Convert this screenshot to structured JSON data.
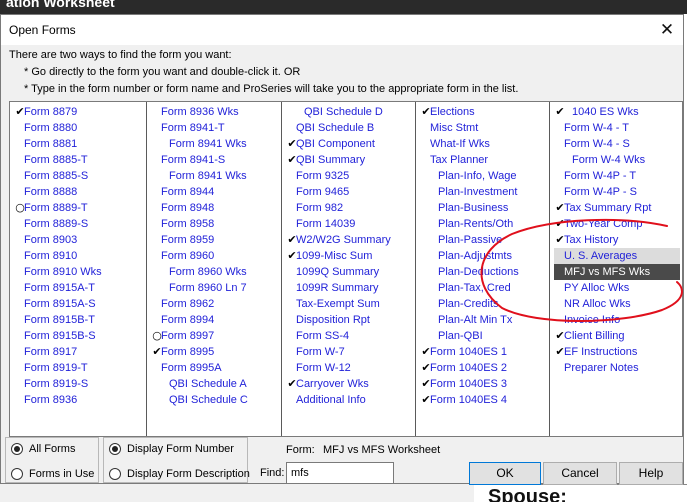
{
  "background": {
    "top_text": "ation Worksheet",
    "spouse_text": "Spouse:"
  },
  "dialog": {
    "title": "Open Forms",
    "close_glyph": "✕",
    "instructions": [
      "There are two ways to find the form you want:",
      "* Go directly to the form you want and double-click it. OR",
      "* Type in the form number or form name and ProSeries will take you to the appropriate form in the list."
    ]
  },
  "columns": [
    [
      {
        "mark": "check",
        "text": "Form 8879"
      },
      {
        "mark": "",
        "text": "Form 8880"
      },
      {
        "mark": "",
        "text": "Form 8881"
      },
      {
        "mark": "",
        "text": "Form 8885-T"
      },
      {
        "mark": "",
        "text": "Form 8885-S"
      },
      {
        "mark": "",
        "text": "Form 8888"
      },
      {
        "mark": "circle",
        "text": "Form 8889-T"
      },
      {
        "mark": "",
        "text": "Form 8889-S"
      },
      {
        "mark": "",
        "text": "Form 8903"
      },
      {
        "mark": "",
        "text": "Form 8910"
      },
      {
        "mark": "",
        "text": "Form 8910 Wks"
      },
      {
        "mark": "",
        "text": "Form 8915A-T"
      },
      {
        "mark": "",
        "text": "Form 8915A-S"
      },
      {
        "mark": "",
        "text": "Form 8915B-T"
      },
      {
        "mark": "",
        "text": "Form 8915B-S"
      },
      {
        "mark": "",
        "text": "Form 8917"
      },
      {
        "mark": "",
        "text": "Form 8919-T"
      },
      {
        "mark": "",
        "text": "Form 8919-S"
      },
      {
        "mark": "",
        "text": "Form 8936"
      }
    ],
    [
      {
        "mark": "",
        "text": "Form 8936 Wks"
      },
      {
        "mark": "",
        "text": "Form 8941-T"
      },
      {
        "mark": "",
        "text": "Form 8941 Wks",
        "indent": 1
      },
      {
        "mark": "",
        "text": "Form 8941-S"
      },
      {
        "mark": "",
        "text": "Form 8941 Wks",
        "indent": 1
      },
      {
        "mark": "",
        "text": "Form 8944"
      },
      {
        "mark": "",
        "text": "Form 8948"
      },
      {
        "mark": "",
        "text": "Form 8958"
      },
      {
        "mark": "",
        "text": "Form 8959"
      },
      {
        "mark": "",
        "text": "Form 8960"
      },
      {
        "mark": "",
        "text": "Form 8960 Wks",
        "indent": 1
      },
      {
        "mark": "",
        "text": "Form 8960 Ln 7",
        "indent": 1
      },
      {
        "mark": "",
        "text": "Form 8962"
      },
      {
        "mark": "",
        "text": "Form 8994"
      },
      {
        "mark": "circle",
        "text": "Form 8997"
      },
      {
        "mark": "check",
        "text": "Form 8995"
      },
      {
        "mark": "",
        "text": "Form 8995A"
      },
      {
        "mark": "",
        "text": "QBI Schedule A",
        "indent": 1
      },
      {
        "mark": "",
        "text": "QBI Schedule C",
        "indent": 1
      }
    ],
    [
      {
        "mark": "",
        "text": "QBI Schedule D",
        "indent": 1
      },
      {
        "mark": "",
        "text": "QBI Schedule B"
      },
      {
        "mark": "check",
        "text": "QBI Component"
      },
      {
        "mark": "check",
        "text": "QBI Summary"
      },
      {
        "mark": "",
        "text": "Form 9325"
      },
      {
        "mark": "",
        "text": "Form 9465"
      },
      {
        "mark": "",
        "text": "Form 982"
      },
      {
        "mark": "",
        "text": "Form 14039"
      },
      {
        "mark": "check",
        "text": "W2/W2G Summary"
      },
      {
        "mark": "check",
        "text": "1099-Misc Sum"
      },
      {
        "mark": "",
        "text": "1099Q Summary"
      },
      {
        "mark": "",
        "text": "1099R Summary"
      },
      {
        "mark": "",
        "text": "Tax-Exempt Sum"
      },
      {
        "mark": "",
        "text": "Disposition Rpt"
      },
      {
        "mark": "",
        "text": "Form SS-4"
      },
      {
        "mark": "",
        "text": "Form W-7"
      },
      {
        "mark": "",
        "text": "Form W-12"
      },
      {
        "mark": "check",
        "text": "Carryover Wks"
      },
      {
        "mark": "",
        "text": "Additional Info"
      }
    ],
    [
      {
        "mark": "check",
        "text": "Elections"
      },
      {
        "mark": "",
        "text": "Misc Stmt"
      },
      {
        "mark": "",
        "text": "What-If Wks"
      },
      {
        "mark": "",
        "text": "Tax Planner"
      },
      {
        "mark": "",
        "text": "Plan-Info, Wage",
        "indent": 1
      },
      {
        "mark": "",
        "text": "Plan-Investment",
        "indent": 1
      },
      {
        "mark": "",
        "text": "Plan-Business",
        "indent": 1
      },
      {
        "mark": "",
        "text": "Plan-Rents/Oth",
        "indent": 1
      },
      {
        "mark": "",
        "text": "Plan-Passive",
        "indent": 1
      },
      {
        "mark": "",
        "text": "Plan-Adjustmts",
        "indent": 1
      },
      {
        "mark": "",
        "text": "Plan-Deductions",
        "indent": 1
      },
      {
        "mark": "",
        "text": "Plan-Tax, Cred",
        "indent": 1
      },
      {
        "mark": "",
        "text": "Plan-Credits",
        "indent": 1
      },
      {
        "mark": "",
        "text": "Plan-Alt Min Tx",
        "indent": 1
      },
      {
        "mark": "",
        "text": "Plan-QBI",
        "indent": 1
      },
      {
        "mark": "check",
        "text": "Form 1040ES 1"
      },
      {
        "mark": "check",
        "text": "Form 1040ES 2"
      },
      {
        "mark": "check",
        "text": "Form 1040ES 3"
      },
      {
        "mark": "check",
        "text": "Form 1040ES 4"
      }
    ],
    [
      {
        "mark": "check",
        "text": "1040 ES Wks",
        "indent": 1
      },
      {
        "mark": "",
        "text": "Form W-4 - T"
      },
      {
        "mark": "",
        "text": "Form W-4 - S"
      },
      {
        "mark": "",
        "text": "Form W-4 Wks",
        "indent": 1
      },
      {
        "mark": "",
        "text": "Form W-4P - T"
      },
      {
        "mark": "",
        "text": "Form W-4P - S"
      },
      {
        "mark": "check",
        "text": "Tax Summary Rpt"
      },
      {
        "mark": "check",
        "text": "Two-Year Comp"
      },
      {
        "mark": "check",
        "text": "Tax History"
      },
      {
        "mark": "",
        "text": "U. S. Averages",
        "state": "hl"
      },
      {
        "mark": "",
        "text": "MFJ vs MFS Wks",
        "state": "selected"
      },
      {
        "mark": "",
        "text": "PY Alloc Wks"
      },
      {
        "mark": "",
        "text": "NR Alloc Wks"
      },
      {
        "mark": "",
        "text": "Invoice Info"
      },
      {
        "mark": "check",
        "text": "Client Billing"
      },
      {
        "mark": "check",
        "text": "EF Instructions"
      },
      {
        "mark": "",
        "text": "Preparer Notes"
      }
    ]
  ],
  "colors": {
    "item_text": "#1f1fd8",
    "selection_bg": "#4a4a4a",
    "annotation": "#e0101c"
  },
  "options": {
    "all_forms": "All Forms",
    "forms_in_use": "Forms in Use",
    "display_number": "Display Form Number",
    "display_description": "Display Form Description",
    "all_forms_selected": true,
    "display_number_selected": true
  },
  "form_label": "Form:",
  "form_value": "MFJ vs MFS Worksheet",
  "find_label": "Find:",
  "find_value": "mfs",
  "buttons": {
    "ok": "OK",
    "cancel": "Cancel",
    "help": "Help"
  }
}
